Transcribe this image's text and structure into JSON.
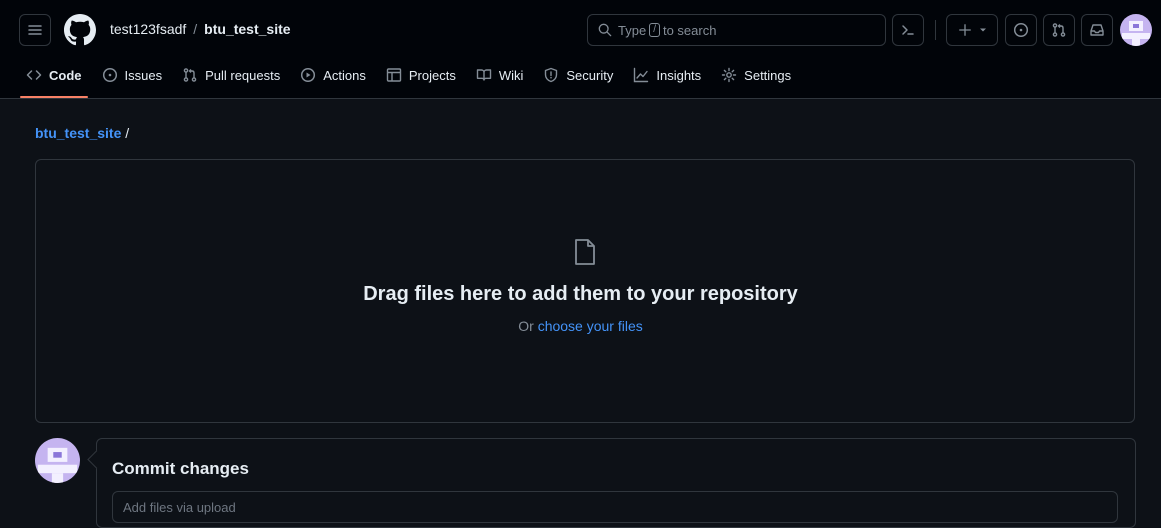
{
  "header": {
    "owner": "test123fsadf",
    "separator": "/",
    "repo": "btu_test_site",
    "search_prefix": "Type",
    "search_key": "/",
    "search_suffix": "to search",
    "icons": [
      "menu-icon",
      "github-logo-icon",
      "search-icon",
      "command-palette-icon",
      "plus-icon",
      "issue-icon",
      "pull-request-icon",
      "inbox-icon",
      "avatar"
    ]
  },
  "tabs": [
    {
      "label": "Code",
      "icon": "code-icon",
      "active": true
    },
    {
      "label": "Issues",
      "icon": "issue-icon"
    },
    {
      "label": "Pull requests",
      "icon": "pull-request-icon"
    },
    {
      "label": "Actions",
      "icon": "play-icon"
    },
    {
      "label": "Projects",
      "icon": "table-icon"
    },
    {
      "label": "Wiki",
      "icon": "book-icon"
    },
    {
      "label": "Security",
      "icon": "shield-icon"
    },
    {
      "label": "Insights",
      "icon": "graph-icon"
    },
    {
      "label": "Settings",
      "icon": "gear-icon"
    }
  ],
  "breadcrumb": {
    "repo": "btu_test_site",
    "separator": "/"
  },
  "upload": {
    "title": "Drag files here to add them to your repository",
    "prefix": "Or",
    "link": "choose your files"
  },
  "commit": {
    "title": "Commit changes",
    "placeholder": "Add files via upload"
  },
  "colors": {
    "background": "#0d1117",
    "header": "#010409",
    "link": "#4493f8",
    "active_tab": "#f78166",
    "border": "#30363d",
    "avatar": "#c5b4f0"
  }
}
